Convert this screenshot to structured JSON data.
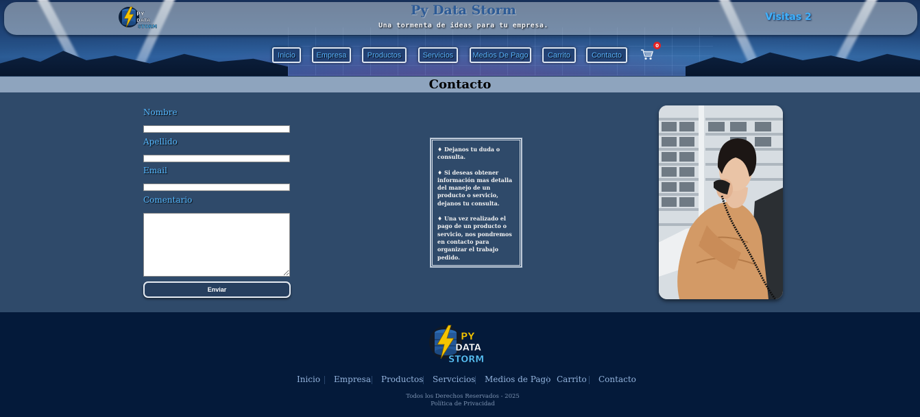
{
  "header": {
    "site_title": "Py Data Storm",
    "tagline": "Una tormenta de ideas para tu empresa.",
    "visits": "Visitas 2",
    "logo_text": [
      "PY",
      "DATA",
      "STORM"
    ],
    "nav": [
      {
        "label": "Inicio"
      },
      {
        "label": "Empresa"
      },
      {
        "label": "Productos"
      },
      {
        "label": "Servicios"
      },
      {
        "label": "Medios De Pago"
      },
      {
        "label": "Carrito"
      },
      {
        "label": "Contacto"
      }
    ],
    "cart_count": "0"
  },
  "section": {
    "title": "Contacto"
  },
  "form": {
    "fields": [
      {
        "label": "Nombre",
        "value": ""
      },
      {
        "label": "Apellido",
        "value": ""
      },
      {
        "label": "Email",
        "value": ""
      },
      {
        "label": "Comentario",
        "value": ""
      }
    ],
    "submit_label": "Enviar"
  },
  "info": {
    "paragraphs": [
      "♦ Dejanos tu duda o consulta.",
      "♦ Si deseas obtener información mas detalla del manejo de un producto o servicio, dejanos tu consulta.",
      "♦ Una vez realizado el pago de un producto o servicio, nos pondremos en contacto para organizar el trabajo pedido."
    ]
  },
  "footer": {
    "logo_text": [
      "PY",
      "DATA",
      "STORM"
    ],
    "links": [
      {
        "label": "Inicio"
      },
      {
        "label": "Empresa"
      },
      {
        "label": "Productos"
      },
      {
        "label": "Servcicios"
      },
      {
        "label": "Medios de Pago"
      },
      {
        "label": "Carrito"
      },
      {
        "label": "Contacto"
      }
    ],
    "copyright": "Todos los Derechos Reservados - 2025",
    "privacy": "Política de Privacidad"
  },
  "colors": {
    "accent": "#55b8ff",
    "body_bg": "#2f4a6a",
    "footer_bg": "#041a3a",
    "section_bar": "#8ea4be",
    "cart_badge": "#e52222"
  },
  "icons": [
    "lightning-database-logo-icon",
    "shopping-cart-icon"
  ]
}
